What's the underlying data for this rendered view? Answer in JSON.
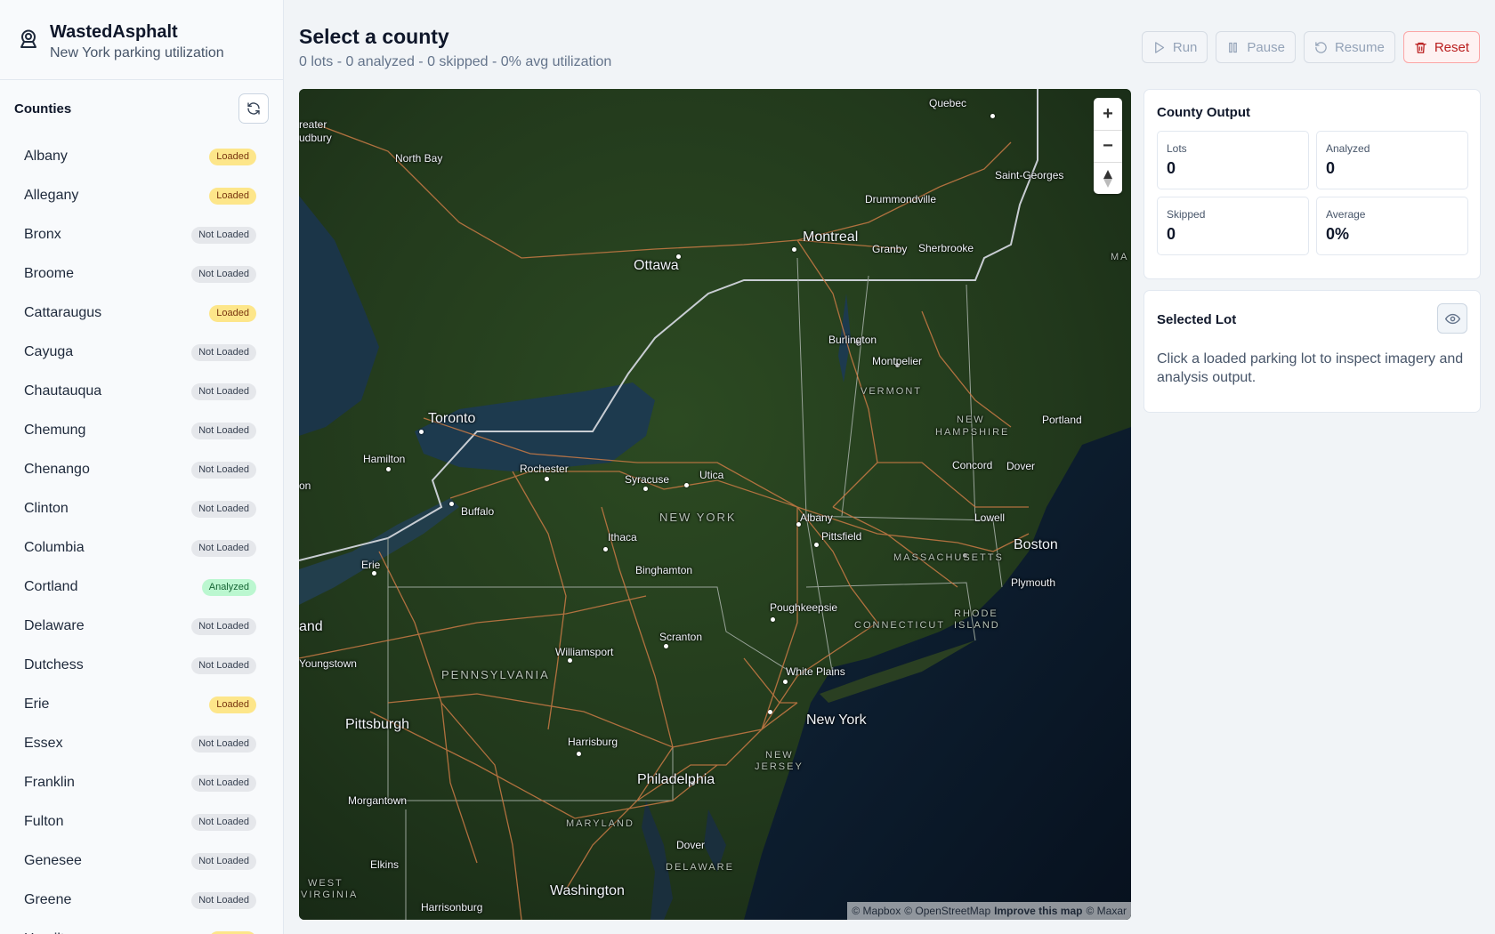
{
  "app": {
    "title": "WastedAsphalt",
    "subtitle": "New York parking utilization"
  },
  "sidebar": {
    "heading": "Counties",
    "counties": [
      {
        "name": "Albany",
        "status": "Loaded"
      },
      {
        "name": "Allegany",
        "status": "Loaded"
      },
      {
        "name": "Bronx",
        "status": "Not Loaded"
      },
      {
        "name": "Broome",
        "status": "Not Loaded"
      },
      {
        "name": "Cattaraugus",
        "status": "Loaded"
      },
      {
        "name": "Cayuga",
        "status": "Not Loaded"
      },
      {
        "name": "Chautauqua",
        "status": "Not Loaded"
      },
      {
        "name": "Chemung",
        "status": "Not Loaded"
      },
      {
        "name": "Chenango",
        "status": "Not Loaded"
      },
      {
        "name": "Clinton",
        "status": "Not Loaded"
      },
      {
        "name": "Columbia",
        "status": "Not Loaded"
      },
      {
        "name": "Cortland",
        "status": "Analyzed"
      },
      {
        "name": "Delaware",
        "status": "Not Loaded"
      },
      {
        "name": "Dutchess",
        "status": "Not Loaded"
      },
      {
        "name": "Erie",
        "status": "Loaded"
      },
      {
        "name": "Essex",
        "status": "Not Loaded"
      },
      {
        "name": "Franklin",
        "status": "Not Loaded"
      },
      {
        "name": "Fulton",
        "status": "Not Loaded"
      },
      {
        "name": "Genesee",
        "status": "Not Loaded"
      },
      {
        "name": "Greene",
        "status": "Not Loaded"
      },
      {
        "name": "Hamilton",
        "status": "Loaded"
      }
    ]
  },
  "header": {
    "title": "Select a county",
    "summary": "0 lots - 0 analyzed - 0 skipped - 0% avg utilization"
  },
  "toolbar": {
    "run": "Run",
    "pause": "Pause",
    "resume": "Resume",
    "reset": "Reset"
  },
  "map": {
    "attribution_mapbox": "© Mapbox",
    "attribution_osm": "© OpenStreetMap",
    "improve": "Improve this map",
    "attribution_maxar": "© Maxar",
    "labels": {
      "quebec": "Quebec",
      "greater": "reater",
      "sudbury": "udbury",
      "north_bay": "North Bay",
      "saint_georges": "Saint-Georges",
      "drummondville": "Drummondville",
      "montreal": "Montreal",
      "granby": "Granby",
      "sherbrooke": "Sherbrooke",
      "ottawa": "Ottawa",
      "ma_edge": "MA",
      "burlington": "Burlington",
      "montpelier": "Montpelier",
      "vermont": "VERMONT",
      "new_hampshire_1": "NEW",
      "new_hampshire_2": "HAMPSHIRE",
      "portland": "Portland",
      "toronto": "Toronto",
      "hamilton": "Hamilton",
      "rochester": "Rochester",
      "syracuse": "Syracuse",
      "utica": "Utica",
      "concord": "Concord",
      "dover_nh": "Dover",
      "on_edge": "on",
      "buffalo": "Buffalo",
      "new_york_state": "NEW YORK",
      "albany": "Albany",
      "lowell": "Lowell",
      "ithaca": "Ithaca",
      "pittsfield": "Pittsfield",
      "boston": "Boston",
      "massachusetts": "MASSACHUSETTS",
      "erie": "Erie",
      "binghamton": "Binghamton",
      "plymouth": "Plymouth",
      "land_edge": "and",
      "poughkeepsie": "Poughkeepsie",
      "rhode": "RHODE",
      "island": "ISLAND",
      "connecticut": "CONNECTICUT",
      "scranton": "Scranton",
      "williamsport": "Williamsport",
      "youngstown": "Youngstown",
      "pennsylvania": "PENNSYLVANIA",
      "white_plains": "White Plains",
      "new_york": "New York",
      "pittsburgh": "Pittsburgh",
      "harrisburg": "Harrisburg",
      "new_jersey_1": "NEW",
      "new_jersey_2": "JERSEY",
      "philadelphia": "Philadelphia",
      "morgantown": "Morgantown",
      "maryland": "MARYLAND",
      "dover_de": "Dover",
      "delaware": "DELAWARE",
      "elkins": "Elkins",
      "west": "WEST",
      "virginia": "VIRGINIA",
      "washington": "Washington",
      "harrisonburg": "Harrisonburg"
    }
  },
  "output": {
    "title": "County Output",
    "lots_label": "Lots",
    "lots": "0",
    "analyzed_label": "Analyzed",
    "analyzed": "0",
    "skipped_label": "Skipped",
    "skipped": "0",
    "average_label": "Average",
    "average": "0%"
  },
  "selected_lot": {
    "title": "Selected Lot",
    "message": "Click a loaded parking lot to inspect imagery and analysis output."
  },
  "colors": {
    "loaded": "#fde68a",
    "not_loaded": "#e5e7eb",
    "analyzed": "#bbf7d0",
    "reset": "#b91c1c"
  }
}
